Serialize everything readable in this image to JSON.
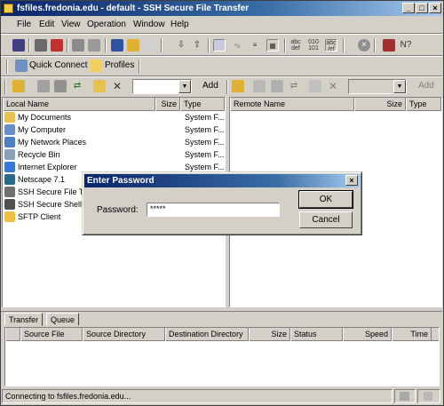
{
  "window": {
    "title": "fsfiles.fredonia.edu - default - SSH Secure File Transfer"
  },
  "menu": [
    {
      "label": "File"
    },
    {
      "label": "Edit"
    },
    {
      "label": "View"
    },
    {
      "label": "Operation"
    },
    {
      "label": "Window"
    },
    {
      "label": "Help"
    }
  ],
  "quickbar": {
    "quick_connect": "Quick Connect",
    "profiles": "Profiles"
  },
  "local_toolbar": {
    "add_label": "Add",
    "path_value": ""
  },
  "remote_toolbar": {
    "add_label": "Add",
    "path_value": ""
  },
  "local_pane": {
    "columns": [
      "Local Name",
      "Size",
      "Type"
    ],
    "rows": [
      {
        "name": "My Documents",
        "type": "System F...",
        "icon": "folder-docs-icon",
        "color": "#e8c050"
      },
      {
        "name": "My Computer",
        "type": "System F...",
        "icon": "computer-icon",
        "color": "#6a8fc8"
      },
      {
        "name": "My Network Places",
        "type": "System F...",
        "icon": "network-icon",
        "color": "#4a7fc0"
      },
      {
        "name": "Recycle Bin",
        "type": "System F...",
        "icon": "recycle-bin-icon",
        "color": "#8aa0b8"
      },
      {
        "name": "Internet Explorer",
        "type": "System F...",
        "icon": "ie-icon",
        "color": "#3a78d8"
      },
      {
        "name": "Netscape 7.1",
        "type": "",
        "icon": "netscape-icon",
        "color": "#2a6a8a"
      },
      {
        "name": "SSH Secure File Tra",
        "type": "",
        "icon": "ssh-file-icon",
        "color": "#707070"
      },
      {
        "name": "SSH Secure Shell C",
        "type": "",
        "icon": "ssh-shell-icon",
        "color": "#505050"
      },
      {
        "name": "SFTP Client",
        "type": "",
        "icon": "folder-icon",
        "color": "#f0c040"
      }
    ]
  },
  "remote_pane": {
    "columns": [
      "Remote Name",
      "Size",
      "Type"
    ]
  },
  "dialog": {
    "title": "Enter Password",
    "password_label": "Password:",
    "password_value": "*****",
    "ok_label": "OK",
    "cancel_label": "Cancel"
  },
  "transfer": {
    "tabs": [
      "Transfer",
      "Queue"
    ],
    "columns": [
      "Source File",
      "Source Directory",
      "Destination Directory",
      "Size",
      "Status",
      "Speed",
      "Time"
    ]
  },
  "status_text": "Connecting to fsfiles.fredonia.edu..."
}
